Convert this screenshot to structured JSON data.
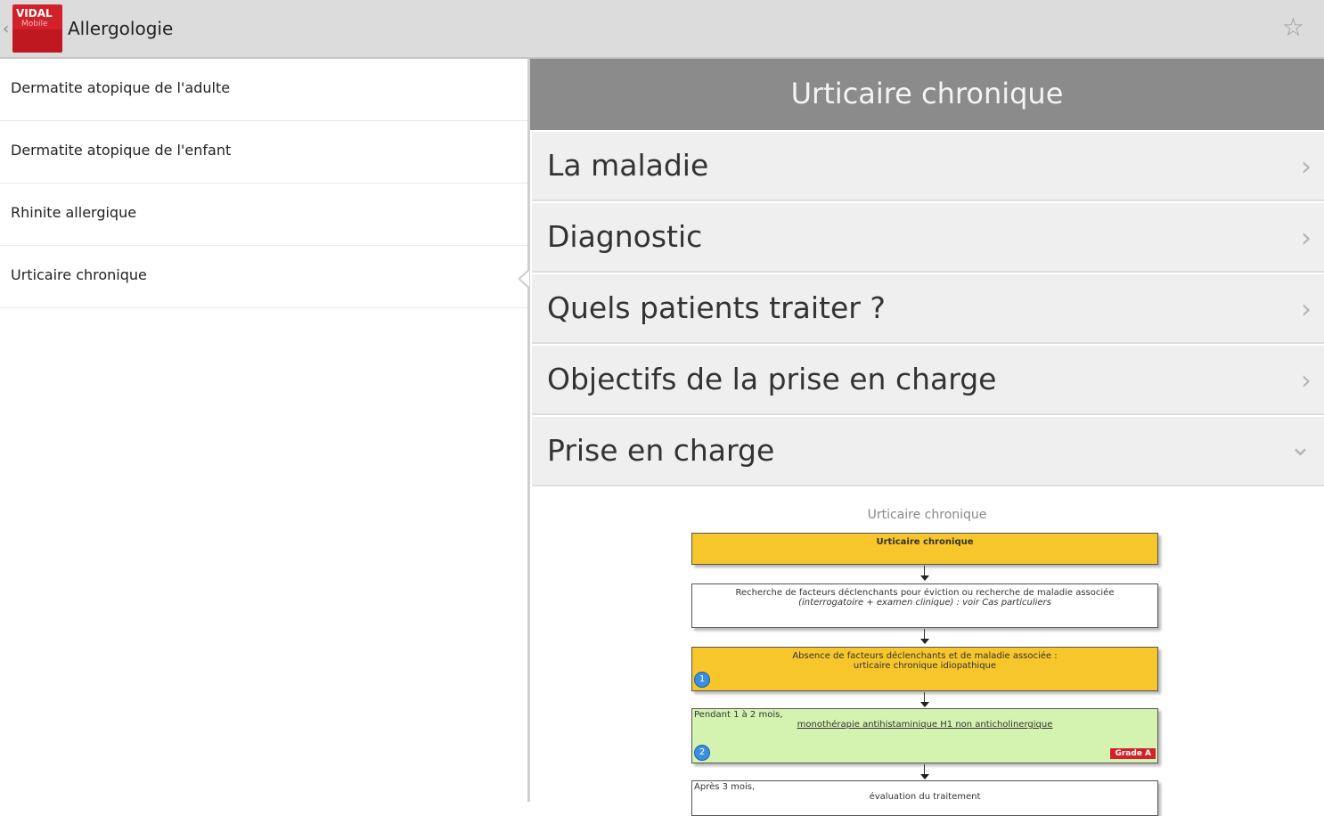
{
  "toolbar": {
    "logo_brand": "VIDAL",
    "logo_sub": "Mobile",
    "title": "Allergologie",
    "back_glyph": "‹",
    "star_glyph": "☆"
  },
  "sidebar": {
    "items": [
      {
        "label": "Dermatite atopique de l'adulte"
      },
      {
        "label": "Dermatite atopique de l'enfant"
      },
      {
        "label": "Rhinite allergique"
      },
      {
        "label": "Urticaire chronique"
      }
    ],
    "selected_index": 3
  },
  "detail": {
    "title": "Urticaire chronique",
    "sections": [
      {
        "label": "La maladie",
        "chevron": "›"
      },
      {
        "label": "Diagnostic",
        "chevron": "›"
      },
      {
        "label": "Quels patients traiter ?",
        "chevron": "›"
      },
      {
        "label": "Objectifs de la prise en charge",
        "chevron": "›"
      },
      {
        "label": "Prise en charge",
        "chevron": "⌄"
      }
    ]
  },
  "flowchart": {
    "title": "Urticaire chronique",
    "box1": "Urticaire chronique",
    "box2_line1": "Recherche de facteurs déclenchants pour éviction ou recherche de maladie associée",
    "box2_line2": "(interrogatoire + examen clinique) : voir Cas particuliers",
    "box3_line1": "Absence de facteurs déclenchants et de maladie associée :",
    "box3_line2": "urticaire chronique idiopathique",
    "box3_badge": "1",
    "box4_line1": "Pendant 1 à 2 mois,",
    "box4_line2": "monothérapie antihistaminique H1 non anticholinergique",
    "box4_badge": "2",
    "box4_grade": "Grade A",
    "box5_line1": "Après 3 mois,",
    "box5_line2": "évaluation du traitement"
  },
  "colors": {
    "brand_red": "#d3212b",
    "header_gray": "#8b8b8b",
    "flow_yellow": "#f7c62a",
    "flow_green": "#d5f3b0"
  }
}
